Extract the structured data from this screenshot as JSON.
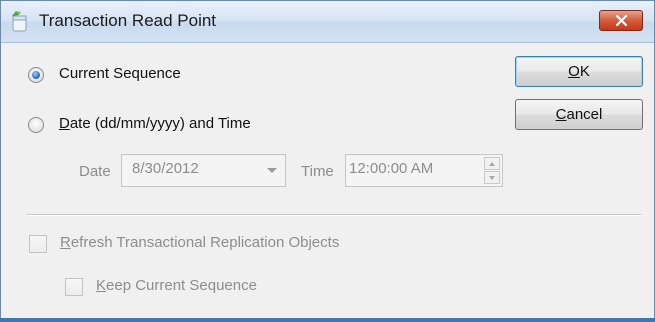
{
  "window": {
    "title": "Transaction Read Point",
    "close_label": "×"
  },
  "options": {
    "current_sequence_pre": "",
    "current_sequence_label": "Current Sequence",
    "current_sequence_selected": true,
    "date_time_underline": "D",
    "date_time_rest": "ate (dd/mm/yyyy) and Time",
    "date_time_selected": false
  },
  "date_field": {
    "label": "Date",
    "value": "8/30/2012"
  },
  "time_field": {
    "label": "Time",
    "value": "12:00:00 AM"
  },
  "buttons": {
    "ok_underline": "O",
    "ok_rest": "K",
    "cancel_underline": "C",
    "cancel_rest": "ancel"
  },
  "checkboxes": {
    "refresh_underline": "R",
    "refresh_rest": "efresh Transactional Replication Objects",
    "refresh_checked": false,
    "keep_underline": "K",
    "keep_rest": "eep Current Sequence",
    "keep_checked": false
  },
  "colors": {
    "accent": "#3c78b4",
    "close_button": "#c6391a",
    "disabled_text": "#8d8d8d"
  }
}
